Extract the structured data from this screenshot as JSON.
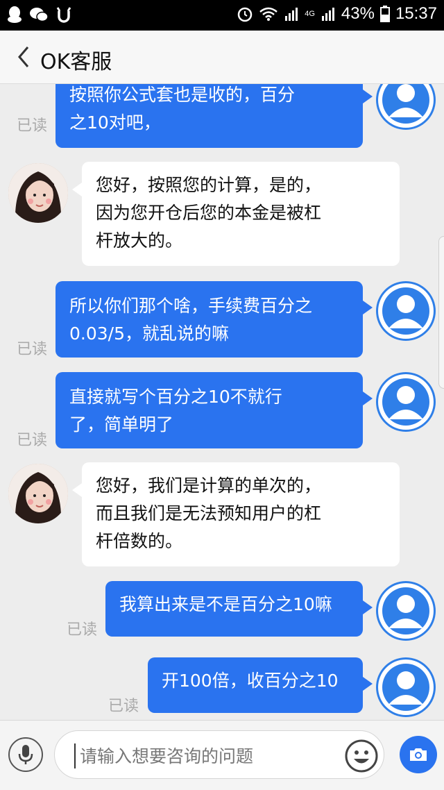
{
  "status_bar": {
    "battery": "43%",
    "time": "15:37",
    "network_label": "4G"
  },
  "header": {
    "title": "OK客服"
  },
  "messages": [
    {
      "side": "right",
      "text": "按照你公式套也是收的，百分\n之10对吧，",
      "read": "已读"
    },
    {
      "side": "left",
      "text": "您好，按照您的计算，是的，\n因为您开仓后您的本金是被杠\n杆放大的。"
    },
    {
      "side": "right",
      "text": "所以你们那个啥，手续费百分之\n0.03/5，就乱说的嘛",
      "read": "已读"
    },
    {
      "side": "right",
      "text": "直接就写个百分之10不就行\n了，简单明了",
      "read": "已读"
    },
    {
      "side": "left",
      "text": "您好，我们是计算的单次的，\n而且我们是无法预知用户的杠\n杆倍数的。"
    },
    {
      "side": "right",
      "text": "我算出来是不是百分之10嘛",
      "read": "已读"
    },
    {
      "side": "right",
      "text": "开100倍，收百分之10",
      "read": "已读"
    }
  ],
  "input": {
    "placeholder": "请输入想要咨询的问题"
  },
  "colors": {
    "accent": "#2a73ef",
    "background": "#ededed"
  },
  "icons": [
    "qq-icon",
    "wechat-icon",
    "alarm-icon",
    "wifi-icon",
    "signal-icon",
    "battery-icon",
    "back-chevron-icon",
    "user-avatar-icon",
    "microphone-icon",
    "emoji-icon",
    "camera-icon"
  ]
}
